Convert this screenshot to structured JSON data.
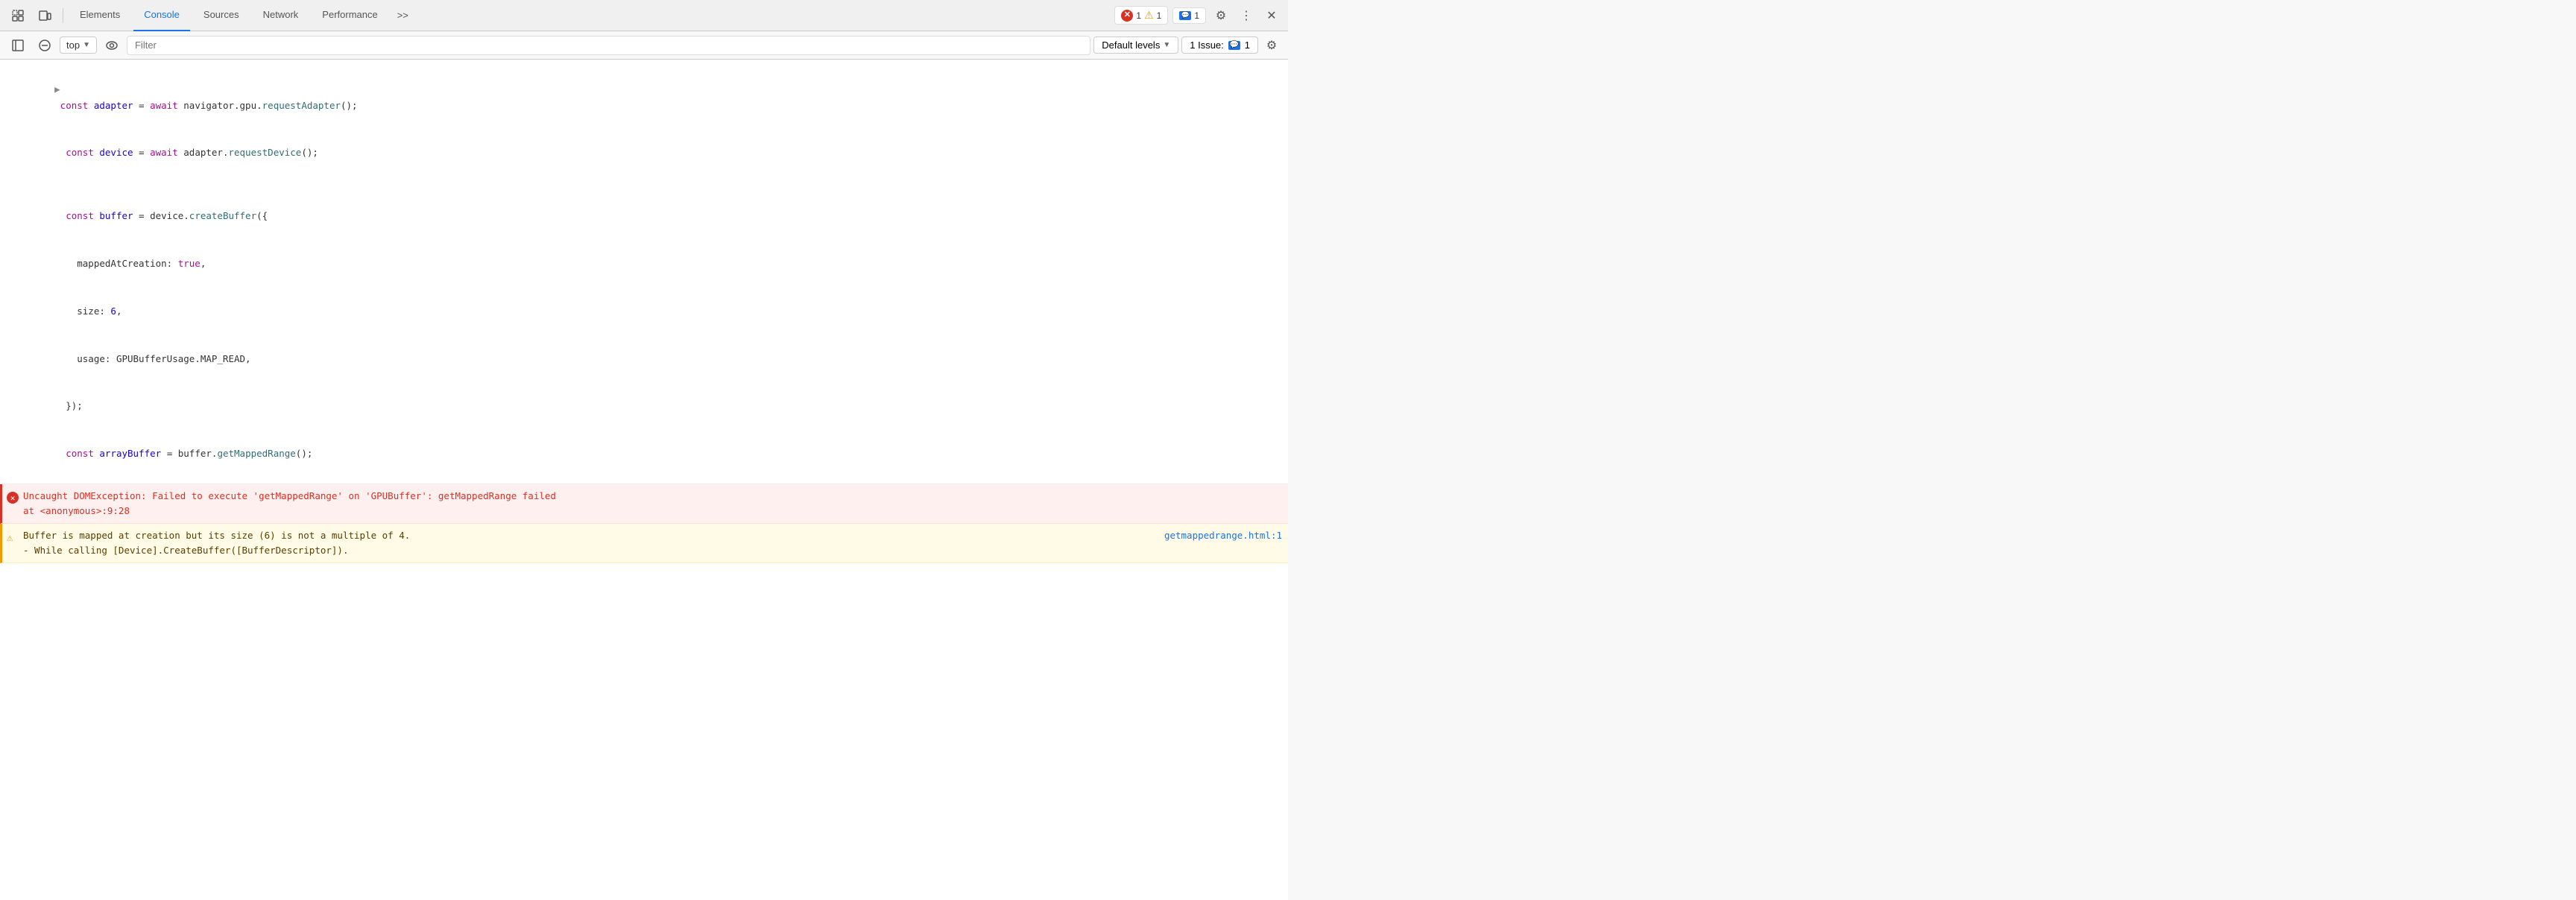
{
  "toolbar": {
    "tabs": [
      {
        "id": "elements",
        "label": "Elements",
        "active": false
      },
      {
        "id": "console",
        "label": "Console",
        "active": true
      },
      {
        "id": "sources",
        "label": "Sources",
        "active": false
      },
      {
        "id": "network",
        "label": "Network",
        "active": false
      },
      {
        "id": "performance",
        "label": "Performance",
        "active": false
      }
    ],
    "more_label": ">>",
    "error_count": "1",
    "warning_count": "1",
    "message_count": "1"
  },
  "second_toolbar": {
    "context": "top",
    "filter_placeholder": "Filter",
    "default_levels_label": "Default levels",
    "issues_label": "1 Issue:",
    "issues_count": "1"
  },
  "console": {
    "code_lines": [
      {
        "text": "> const adapter = await navigator.gpu.requestAdapter();",
        "type": "code"
      },
      {
        "text": "  const device = await adapter.requestDevice();",
        "type": "code"
      },
      {
        "text": "",
        "type": "blank"
      },
      {
        "text": "  const buffer = device.createBuffer({",
        "type": "code"
      },
      {
        "text": "    mappedAtCreation: true,",
        "type": "code"
      },
      {
        "text": "    size: 6,",
        "type": "code"
      },
      {
        "text": "    usage: GPUBufferUsage.MAP_READ,",
        "type": "code"
      },
      {
        "text": "  });",
        "type": "code"
      },
      {
        "text": "  const arrayBuffer = buffer.getMappedRange();",
        "type": "code"
      }
    ],
    "error": {
      "message": "Uncaught DOMException: Failed to execute 'getMappedRange' on 'GPUBuffer': getMappedRange failed",
      "location": "    at <anonymous>:9:28"
    },
    "warning": {
      "message": "Buffer is mapped at creation but its size (6) is not a multiple of 4.",
      "sub_message": "  - While calling [Device].CreateBuffer([BufferDescriptor]).",
      "link_text": "getmappedrange.html:1"
    }
  }
}
